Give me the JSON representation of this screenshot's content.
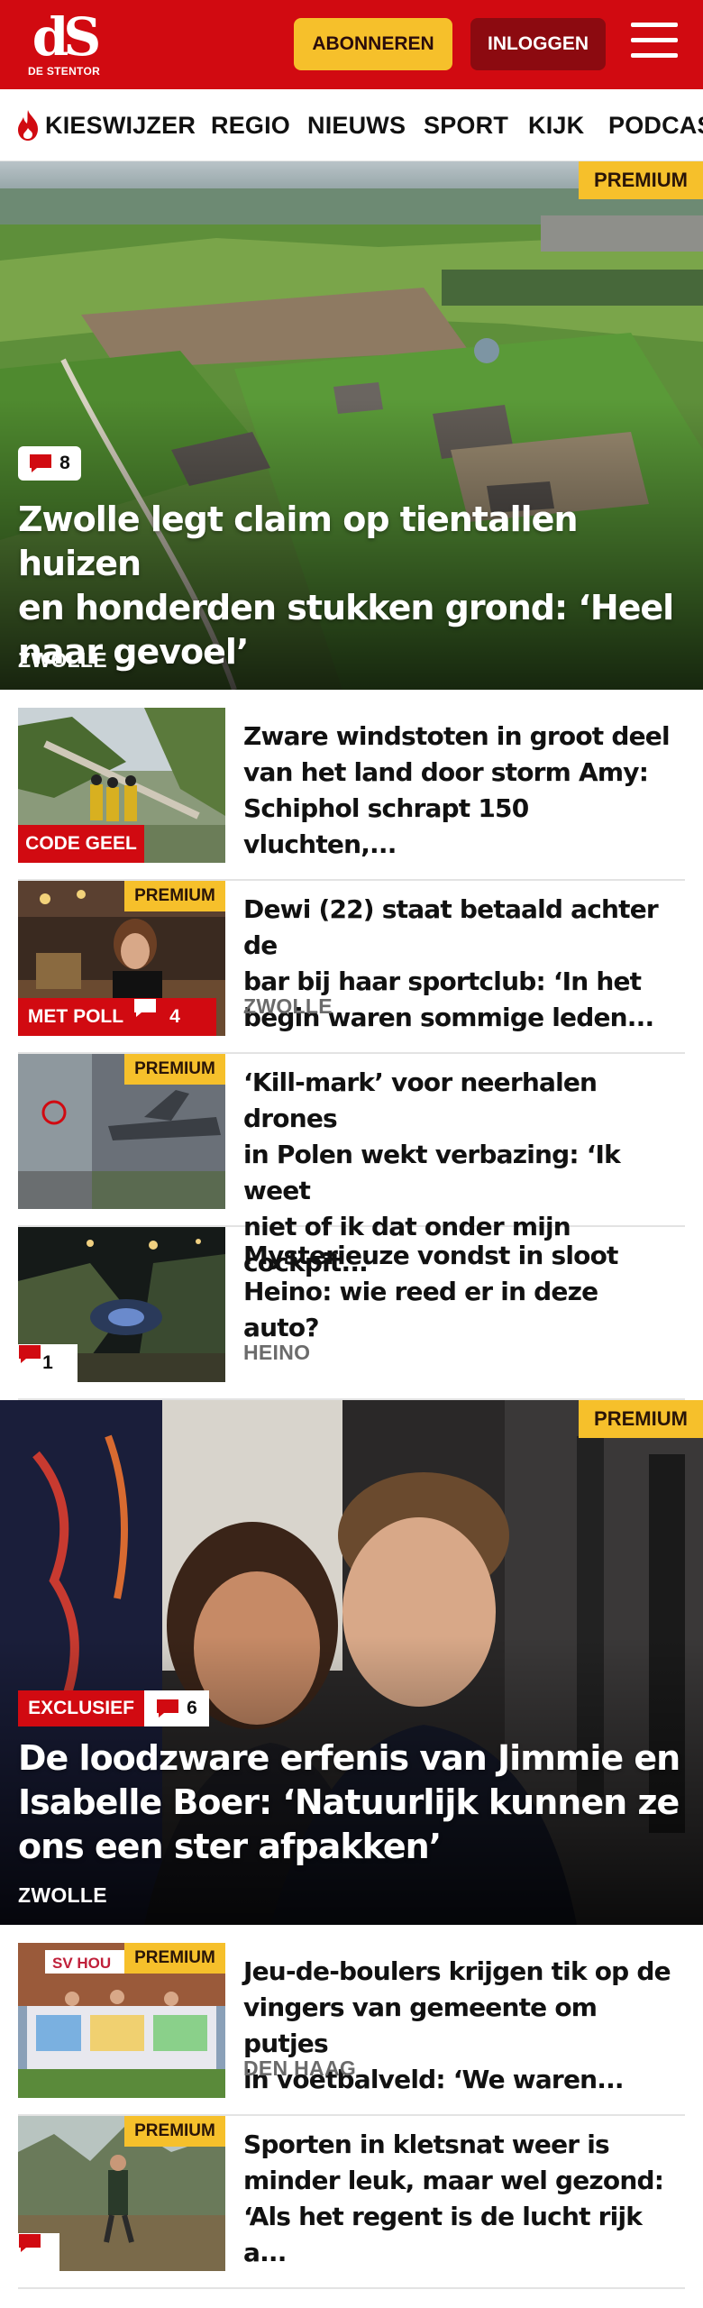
{
  "brand": {
    "logo_mark": "dS",
    "logo_sub": "DE STENTOR",
    "red": "#d10a11",
    "yellow": "#f6c02b"
  },
  "header": {
    "subscribe_label": "ABONNEREN",
    "login_label": "INLOGGEN",
    "menu_icon": "hamburger-icon"
  },
  "nav": {
    "items": [
      "KIESWIJZER",
      "REGIO",
      "NIEUWS",
      "SPORT",
      "KIJK",
      "PODCAS"
    ],
    "first_icon": "flame-icon"
  },
  "hero": {
    "premium": "PREMIUM",
    "comments": "8",
    "title_lines": [
      "Zwolle legt claim op tientallen huizen",
      "en honderden stukken grond: ‘Heel",
      "naar gevoel’"
    ],
    "location": "ZWOLLE"
  },
  "articles": [
    {
      "title_lines": [
        "Zware windstoten in groot deel",
        "van het land door storm Amy:",
        "Schiphol schrapt 150 vluchten,..."
      ],
      "tag": "CODE GEEL",
      "location": ""
    },
    {
      "title_lines": [
        "Dewi (22) staat betaald achter de",
        "bar bij haar sportclub: ‘In het",
        "begin waren sommige leden..."
      ],
      "premium": "PREMIUM",
      "tag": "MET POLL",
      "comments": "4",
      "location": "ZWOLLE"
    },
    {
      "title_lines": [
        "‘Kill-mark’ voor neerhalen drones",
        "in Polen wekt verbazing: ‘Ik weet",
        "niet of ik dat onder mijn cockpit..."
      ],
      "premium": "PREMIUM",
      "location": ""
    },
    {
      "title_lines": [
        "Mysterieuze vondst in sloot",
        "Heino: wie reed er in deze auto?"
      ],
      "comments": "1",
      "location": "HEINO"
    }
  ],
  "hero2": {
    "premium": "PREMIUM",
    "tag": "EXCLUSIEF",
    "comments": "6",
    "title_lines": [
      "De loodzware erfenis van Jimmie en",
      "Isabelle Boer: ‘Natuurlijk kunnen ze",
      "ons een ster afpakken’"
    ],
    "location": "ZWOLLE"
  },
  "articles2": [
    {
      "title_lines": [
        "Jeu-de-boulers krijgen tik op de",
        "vingers van gemeente om putjes",
        "in voetbalveld: ‘We waren..."
      ],
      "premium": "PREMIUM",
      "thumb_sign": "SV HOU",
      "location": "DEN HAAG"
    },
    {
      "title_lines": [
        "Sporten in kletsnat weer is",
        "minder leuk, maar wel gezond:",
        "‘Als het regent is de lucht rijk a..."
      ],
      "premium": "PREMIUM",
      "location": ""
    }
  ]
}
